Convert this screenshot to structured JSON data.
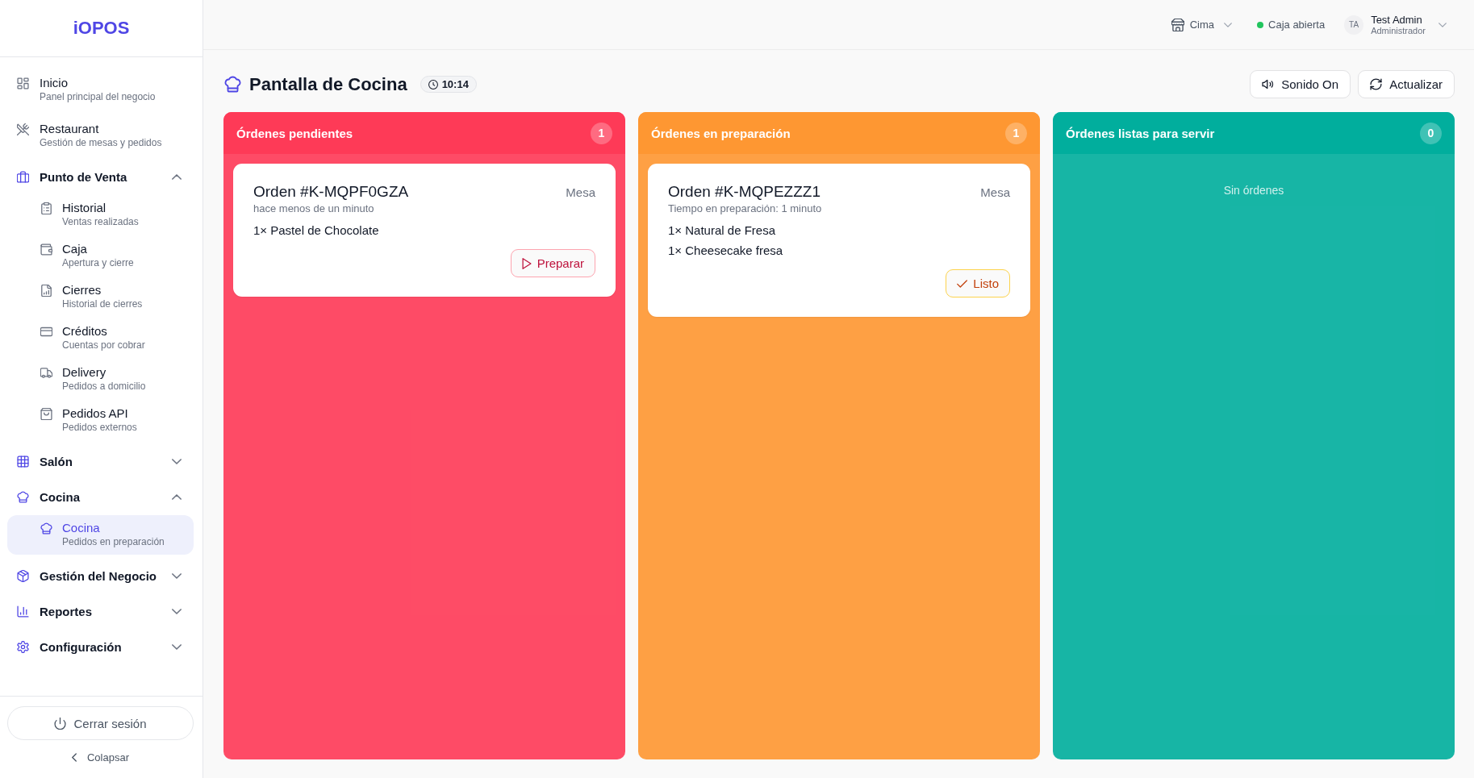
{
  "sidebar": {
    "logo": "iOPOS",
    "nav": [
      {
        "kind": "link",
        "label": "Inicio",
        "subtitle": "Panel principal del negocio",
        "selected": false
      },
      {
        "kind": "link",
        "label": "Restaurant",
        "subtitle": "Gestión de mesas y pedidos",
        "selected": false
      },
      {
        "kind": "section",
        "label": "Punto de Venta",
        "expanded": true,
        "children": [
          {
            "label": "Historial",
            "subtitle": "Ventas realizadas",
            "selected": false
          },
          {
            "label": "Caja",
            "subtitle": "Apertura y cierre",
            "selected": false
          },
          {
            "label": "Cierres",
            "subtitle": "Historial de cierres",
            "selected": false
          },
          {
            "label": "Créditos",
            "subtitle": "Cuentas por cobrar",
            "selected": false
          },
          {
            "label": "Delivery",
            "subtitle": "Pedidos a domicilio",
            "selected": false
          },
          {
            "label": "Pedidos API",
            "subtitle": "Pedidos externos",
            "selected": false
          }
        ]
      },
      {
        "kind": "section",
        "label": "Salón",
        "expanded": false
      },
      {
        "kind": "section",
        "label": "Cocina",
        "expanded": true,
        "children": [
          {
            "label": "Cocina",
            "subtitle": "Pedidos en preparación",
            "selected": true
          }
        ]
      },
      {
        "kind": "section",
        "label": "Gestión del Negocio",
        "expanded": false
      },
      {
        "kind": "section",
        "label": "Reportes",
        "expanded": false
      },
      {
        "kind": "section",
        "label": "Configuración",
        "expanded": false
      }
    ],
    "logout": "Cerrar sesión",
    "collapse": "Colapsar"
  },
  "topbar": {
    "store": "Cima",
    "cash_register": {
      "label": "Caja abierta",
      "open": true
    },
    "user": {
      "initials": "TA",
      "name": "Test Admin",
      "role": "Administrador"
    }
  },
  "page": {
    "title": "Pantalla de Cocina",
    "clock": "10:14",
    "buttons": [
      {
        "label": "Sonido On"
      },
      {
        "label": "Actualizar"
      }
    ]
  },
  "columns": [
    {
      "title": "Órdenes pendientes",
      "count": "1",
      "color": "#fe3a57",
      "orders": [
        {
          "number": "Orden #K-MQPF0GZA",
          "table": "Mesa",
          "time": "hace menos de un minuto",
          "items": [
            "1× Pastel de Chocolate"
          ],
          "action": {
            "kind": "start",
            "label": "Preparar"
          }
        }
      ]
    },
    {
      "title": "Órdenes en preparación",
      "count": "1",
      "color": "#fe9732",
      "orders": [
        {
          "number": "Orden #K-MQPEZZZ1",
          "table": "Mesa",
          "time": "Tiempo en preparación: 1 minuto",
          "items": [
            "1× Natural de Fresa",
            "1× Cheesecake fresa"
          ],
          "action": {
            "kind": "done",
            "label": "Listo"
          }
        }
      ]
    },
    {
      "title": "Órdenes listas para servir",
      "count": "0",
      "color": "#01ae9d",
      "empty_text": "Sin órdenes"
    }
  ]
}
